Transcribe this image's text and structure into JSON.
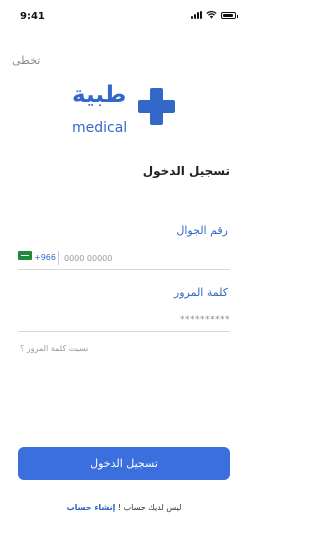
{
  "status_bar": {
    "time": "9:41",
    "icons": [
      "signal-icon",
      "wifi-icon",
      "battery-icon"
    ]
  },
  "header": {
    "skip_label": "تخطى"
  },
  "logo": {
    "arabic": "طبية",
    "english": "medical",
    "color": "#3468c8"
  },
  "form": {
    "title": "تسجيل الدخول",
    "phone_label": "رقم الجوال",
    "country_code": "+966",
    "phone_placeholder": "0000 00000",
    "password_label": "كلمة المرور",
    "password_placeholder": "**********",
    "forgot_password": "نسيت كلمة المرور ؟",
    "login_button": "تسجيل الدخول"
  },
  "footer": {
    "no_account_text": "ليس لديك حساب !",
    "create_account_link": "إنشاء حساب"
  },
  "colors": {
    "accent": "#3b6fde",
    "brand": "#3468c8"
  }
}
